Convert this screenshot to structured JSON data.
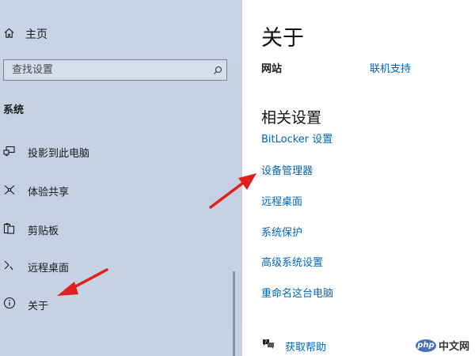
{
  "sidebar": {
    "home_label": "主页",
    "search_placeholder": "查找设置",
    "section_title": "系统",
    "items": [
      {
        "label": "投影到此电脑",
        "icon": "project-to-pc-icon"
      },
      {
        "label": "体验共享",
        "icon": "shared-experiences-icon"
      },
      {
        "label": "剪贴板",
        "icon": "clipboard-icon"
      },
      {
        "label": "远程桌面",
        "icon": "remote-desktop-icon"
      },
      {
        "label": "关于",
        "icon": "info-icon"
      }
    ]
  },
  "main": {
    "title": "关于",
    "site_label": "网站",
    "support_link": "联机支持",
    "related_title": "相关设置",
    "related_links": [
      "BitLocker 设置",
      "设备管理器",
      "远程桌面",
      "系统保护",
      "高级系统设置",
      "重命名这台电脑"
    ],
    "help_label": "获取帮助"
  },
  "watermark": {
    "logo": "php",
    "text": "中文网"
  },
  "colors": {
    "sidebar_bg": "#c7d2e4",
    "link": "#0067b8",
    "arrow": "#e0201e"
  }
}
